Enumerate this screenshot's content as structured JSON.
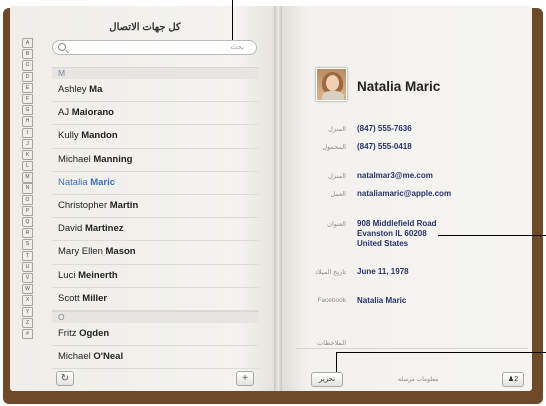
{
  "left_page": {
    "title": "كل جهات الاتصال",
    "search_placeholder": "بحث",
    "alphabet": [
      "A",
      "B",
      "C",
      "D",
      "E",
      "F",
      "G",
      "H",
      "I",
      "J",
      "K",
      "L",
      "M",
      "N",
      "O",
      "P",
      "Q",
      "R",
      "S",
      "T",
      "U",
      "V",
      "W",
      "X",
      "Y",
      "Z",
      "#"
    ],
    "sections": [
      {
        "letter": "M",
        "rows": [
          {
            "first": "Ashley",
            "last": "Ma"
          },
          {
            "first": "AJ",
            "last": "Maiorano"
          },
          {
            "first": "Kully",
            "last": "Mandon"
          },
          {
            "first": "Michael",
            "last": "Manning"
          },
          {
            "first": "Natalia",
            "last": "Maric",
            "selected": true
          },
          {
            "first": "Christopher",
            "last": "Martin"
          },
          {
            "first": "David",
            "last": "Martinez"
          },
          {
            "first": "Mary Ellen",
            "last": "Mason"
          },
          {
            "first": "Luci",
            "last": "Meinerth"
          },
          {
            "first": "Scott",
            "last": "Miller"
          }
        ]
      },
      {
        "letter": "O",
        "rows": [
          {
            "first": "Fritz",
            "last": "Ogden"
          },
          {
            "first": "Michael",
            "last": "O'Neal"
          }
        ]
      }
    ],
    "refresh_icon": "↻",
    "add_icon": "+"
  },
  "right_page": {
    "name": "Natalia Maric",
    "fields": {
      "home_label": "المنزل",
      "home_phone": "(847) 555-7636",
      "mobile_label": "المحمول",
      "mobile_phone": "(847) 555-0418",
      "home_email_label": "المنزل",
      "home_email": "natalmar3@me.com",
      "work_label": "العمل",
      "work_email": "nataliamaric@apple.com",
      "address_label": "العنوان",
      "address_line1": "908 Middlefield Road",
      "address_line2": "Evanston IL 60208",
      "address_line3": "United States",
      "birthday_label": "تاريخ الميلاد",
      "birthday": "June 11, 1978",
      "facebook_label": "Facebook",
      "facebook": "Natalia Maric",
      "notes_label": "الملاحظات"
    },
    "edit_button": "تحرير",
    "share_label": "معلومات مرسلة",
    "count_button": "2"
  }
}
